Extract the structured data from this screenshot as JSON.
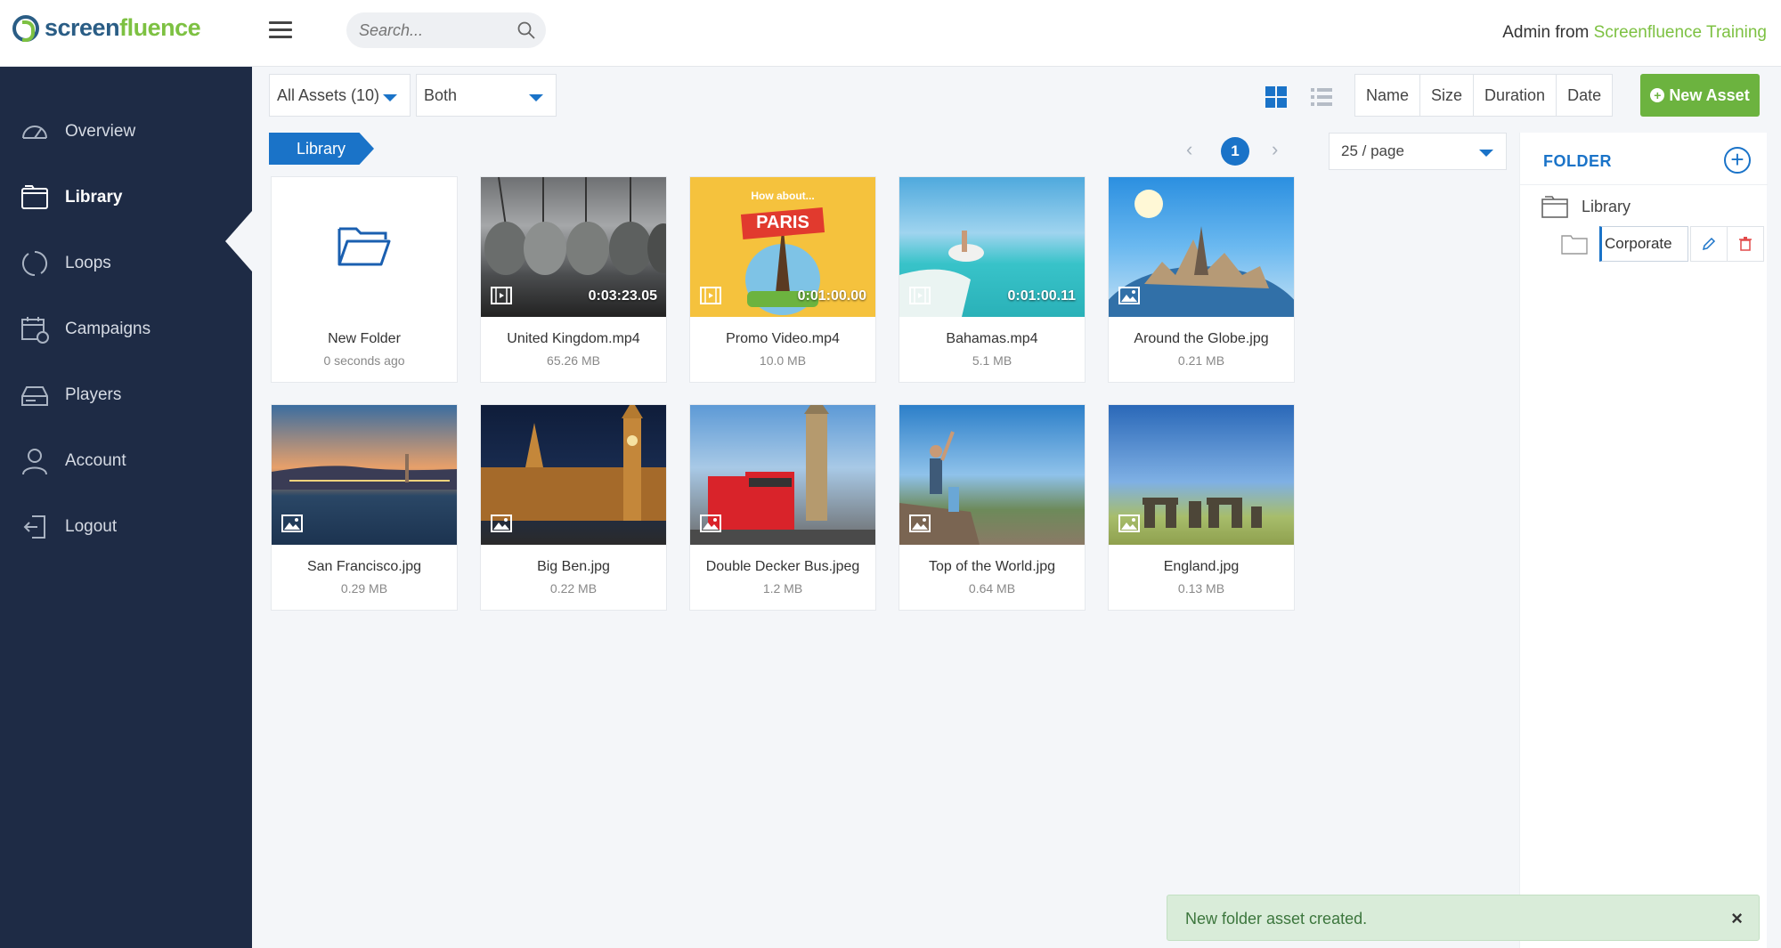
{
  "header": {
    "logo_prefix": "screen",
    "logo_suffix": "fluence",
    "search_placeholder": "Search...",
    "user_name": "Admin",
    "user_from": " from ",
    "org_name": "Screenfluence Training"
  },
  "sidebar": {
    "items": [
      {
        "label": "Overview",
        "icon": "gauge-icon"
      },
      {
        "label": "Library",
        "icon": "folder-icon",
        "active": true
      },
      {
        "label": "Loops",
        "icon": "loop-icon"
      },
      {
        "label": "Campaigns",
        "icon": "calendar-icon"
      },
      {
        "label": "Players",
        "icon": "player-icon"
      },
      {
        "label": "Account",
        "icon": "user-icon"
      },
      {
        "label": "Logout",
        "icon": "logout-icon"
      }
    ]
  },
  "toolbar": {
    "filter_assets": "All Assets (10)",
    "filter_type": "Both",
    "sort": [
      "Name",
      "Size",
      "Duration",
      "Date"
    ],
    "new_asset": "New Asset"
  },
  "breadcrumb": "Library",
  "pagination": {
    "current_page": "1",
    "per_page": "25 / page"
  },
  "assets": [
    {
      "name": "New Folder",
      "meta": "0 seconds ago",
      "kind": "folder"
    },
    {
      "name": "United Kingdom.mp4",
      "meta": "65.26 MB",
      "kind": "video",
      "duration": "0:03:23.05"
    },
    {
      "name": "Promo Video.mp4",
      "meta": "10.0 MB",
      "kind": "video",
      "duration": "0:01:00.00"
    },
    {
      "name": "Bahamas.mp4",
      "meta": "5.1 MB",
      "kind": "video",
      "duration": "0:01:00.11"
    },
    {
      "name": "Around the Globe.jpg",
      "meta": "0.21 MB",
      "kind": "image"
    },
    {
      "name": "San Francisco.jpg",
      "meta": "0.29 MB",
      "kind": "image"
    },
    {
      "name": "Big Ben.jpg",
      "meta": "0.22 MB",
      "kind": "image"
    },
    {
      "name": "Double Decker Bus.jpeg",
      "meta": "1.2 MB",
      "kind": "image"
    },
    {
      "name": "Top of the World.jpg",
      "meta": "0.64 MB",
      "kind": "image"
    },
    {
      "name": "England.jpg",
      "meta": "0.13 MB",
      "kind": "image"
    }
  ],
  "promo_thumb": {
    "line1": "How about...",
    "line2": "PARIS"
  },
  "folder_panel": {
    "title": "FOLDER",
    "root": "Library",
    "editing_value": "Corporate"
  },
  "toast": {
    "message": "New folder asset created.",
    "close": "×"
  },
  "colors": {
    "sidebar_bg": "#1e2b45",
    "accent_blue": "#1a73c8",
    "accent_green": "#6cb33f",
    "toast_bg": "#d9ecd9"
  }
}
